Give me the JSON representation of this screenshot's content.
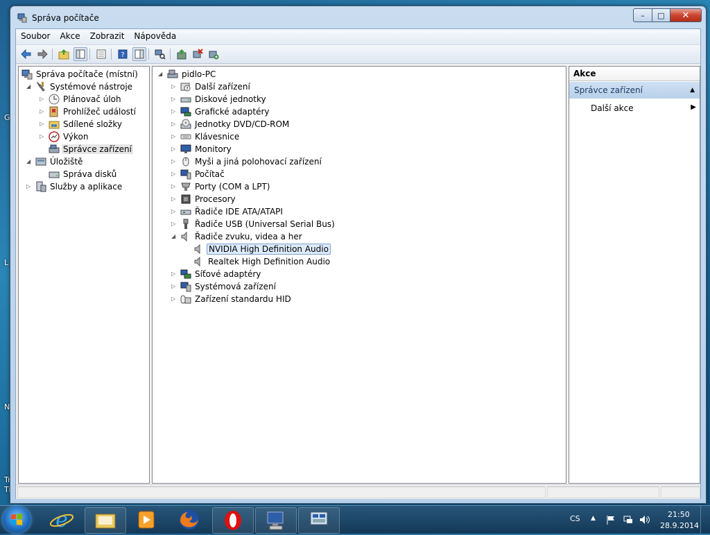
{
  "desktop": {
    "letters": [
      "G",
      "L",
      "N",
      "Tr",
      "Ti"
    ]
  },
  "window": {
    "title": "Správa počítače",
    "caption": {
      "minimize": "–",
      "maximize": "□",
      "close": "✕"
    }
  },
  "menu": [
    "Soubor",
    "Akce",
    "Zobrazit",
    "Nápověda"
  ],
  "toolbar": {
    "buttons": [
      "back-arrow-icon",
      "forward-arrow-icon",
      "up-folder-icon",
      "show-hide-tree-icon",
      "properties-icon",
      "help-icon",
      "show-hide-action-pane-icon",
      "scan-hardware-icon",
      "update-driver-icon",
      "uninstall-device-icon",
      "add-legacy-device-icon"
    ]
  },
  "tree": {
    "root": "Správa počítače (místní)",
    "system_tools": "Systémové nástroje",
    "task_scheduler": "Plánovač úloh",
    "event_viewer": "Prohlížeč událostí",
    "shared_folders": "Sdílené složky",
    "performance": "Výkon",
    "device_manager": "Správce zařízení",
    "storage": "Úložiště",
    "disk_management": "Správa disků",
    "services": "Služby a aplikace"
  },
  "devices": {
    "computer": "pidlo-PC",
    "categories": [
      "Další zařízení",
      "Diskové jednotky",
      "Grafické adaptéry",
      "Jednotky DVD/CD-ROM",
      "Klávesnice",
      "Monitory",
      "Myši a jiná polohovací zařízení",
      "Počítač",
      "Porty (COM a LPT)",
      "Procesory",
      "Řadiče IDE ATA/ATAPI",
      "Řadiče USB (Universal Serial Bus)",
      "Řadiče zvuku, videa a her",
      "Síťové adaptéry",
      "Systémová zařízení",
      "Zařízení standardu HID"
    ],
    "audio_children": [
      "NVIDIA High Definition Audio",
      "Realtek High Definition Audio"
    ]
  },
  "actions": {
    "header": "Akce",
    "section": "Správce zařízení",
    "more": "Další akce"
  },
  "taskbar": {
    "apps": [
      "ie-icon",
      "explorer-icon",
      "media-player-icon",
      "firefox-icon",
      "opera-icon",
      "remote-desktop-icon",
      "computer-management-icon"
    ],
    "language": "CS",
    "time": "21:50",
    "date": "28.9.2014"
  }
}
